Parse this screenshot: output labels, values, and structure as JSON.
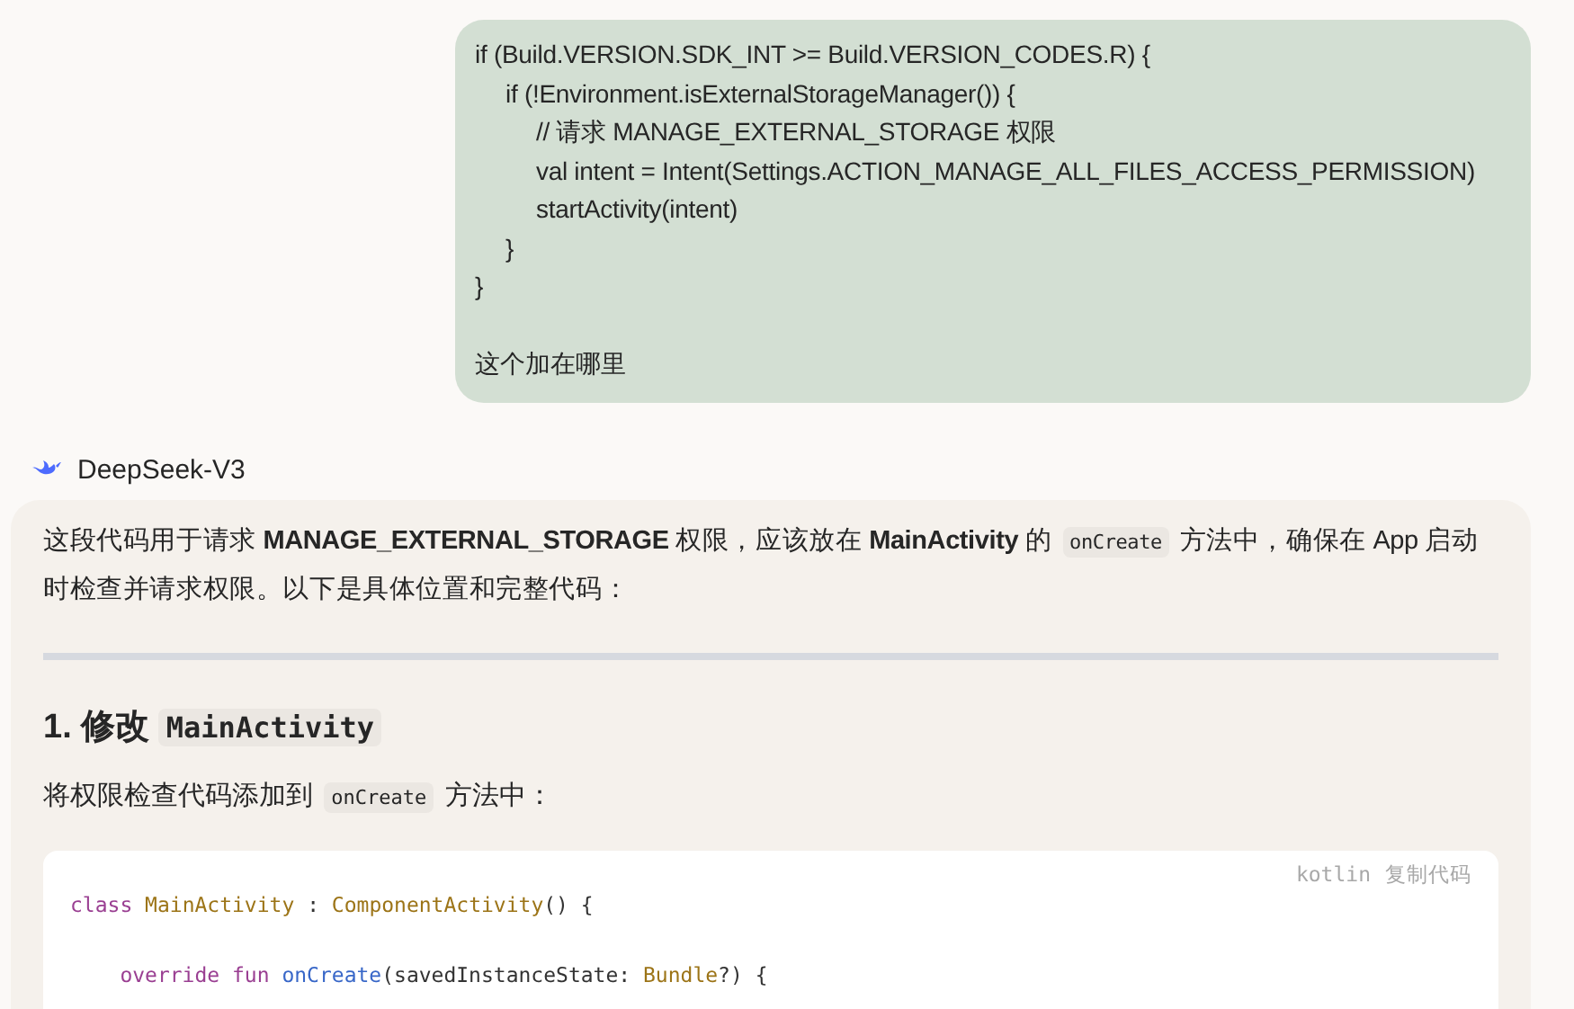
{
  "user_message": {
    "code_lines": [
      {
        "text": "if (Build.VERSION.SDK_INT >= Build.VERSION_CODES.R) {",
        "children": [
          {
            "text": "if (!Environment.isExternalStorageManager()) {",
            "children": [
              {
                "text": "// 请求 MANAGE_EXTERNAL_STORAGE 权限"
              },
              {
                "text": "val intent = Intent(Settings.ACTION_MANAGE_ALL_FILES_ACCESS_PERMISSION)"
              },
              {
                "text": "startActivity(intent)"
              }
            ]
          },
          {
            "text": "}"
          }
        ]
      },
      {
        "text": "}"
      }
    ],
    "question": "这个加在哪里"
  },
  "assistant": {
    "name": "DeepSeek-V3",
    "intro": [
      {
        "kind": "text",
        "text": "这段代码用于请求 **MANAGE_EXTERNAL_STORAGE** 权限，应该放在 **MainActivity** 的 "
      },
      {
        "kind": "code",
        "text": "onCreate"
      },
      {
        "kind": "text",
        "text": " 方法中，确保在 App 启动时检查并请求权限。以下是具体位置和完整代码："
      }
    ],
    "heading": [
      {
        "kind": "text",
        "text": "1. 修改 "
      },
      {
        "kind": "code",
        "text": "MainActivity"
      }
    ],
    "step": [
      {
        "kind": "text",
        "text": "将权限检查代码添加到 "
      },
      {
        "kind": "code",
        "text": "onCreate"
      },
      {
        "kind": "text",
        "text": " 方法中："
      }
    ],
    "code_block": {
      "language": "kotlin",
      "copy_label": "复制代码",
      "lines": [
        {
          "tokens": [
            {
              "kind": "keyword",
              "text": "class "
            },
            {
              "kind": "type",
              "text": "MainActivity"
            },
            {
              "kind": "plain",
              "text": " : "
            },
            {
              "kind": "type",
              "text": "ComponentActivity"
            },
            {
              "kind": "plain",
              "text": "() {"
            }
          ]
        },
        {
          "tokens": [
            {
              "kind": "keyword",
              "text": "    override fun "
            },
            {
              "kind": "func",
              "text": "onCreate"
            },
            {
              "kind": "plain",
              "text": "(savedInstanceState: "
            },
            {
              "kind": "type",
              "text": "Bundle"
            },
            {
              "kind": "plain",
              "text": "?) {"
            }
          ]
        }
      ]
    }
  }
}
